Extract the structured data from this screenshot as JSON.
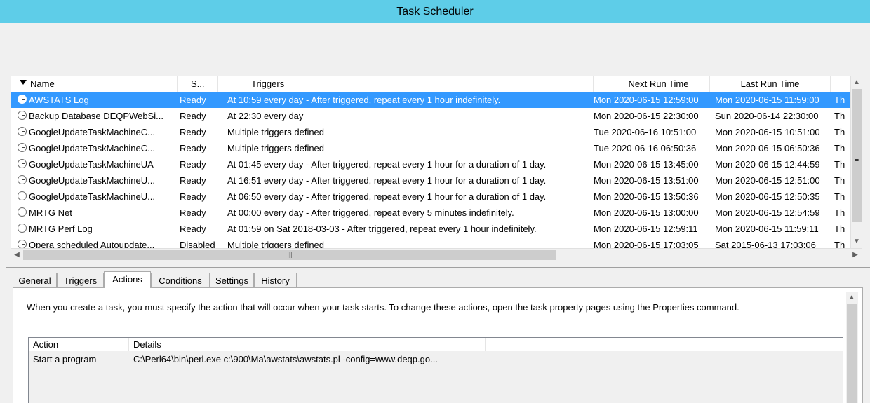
{
  "window": {
    "title": "Task Scheduler"
  },
  "task_list": {
    "columns": [
      "Name",
      "S...",
      "Triggers",
      "Next Run Time",
      "Last Run Time"
    ],
    "rows": [
      {
        "name": "AWSTATS Log",
        "status": "Ready",
        "triggers": "At 10:59 every day - After triggered, repeat every 1 hour indefinitely.",
        "next_run": "Mon 2020-06-15 12:59:00",
        "last_run": "Mon 2020-06-15 11:59:00",
        "extra": "Th",
        "selected": true
      },
      {
        "name": "Backup Database DEQPWebSi...",
        "status": "Ready",
        "triggers": "At 22:30 every day",
        "next_run": "Mon 2020-06-15 22:30:00",
        "last_run": "Sun 2020-06-14 22:30:00",
        "extra": "Th"
      },
      {
        "name": "GoogleUpdateTaskMachineC...",
        "status": "Ready",
        "triggers": "Multiple triggers defined",
        "next_run": "Tue 2020-06-16 10:51:00",
        "last_run": "Mon 2020-06-15 10:51:00",
        "extra": "Th"
      },
      {
        "name": "GoogleUpdateTaskMachineC...",
        "status": "Ready",
        "triggers": "Multiple triggers defined",
        "next_run": "Tue 2020-06-16 06:50:36",
        "last_run": "Mon 2020-06-15 06:50:36",
        "extra": "Th"
      },
      {
        "name": "GoogleUpdateTaskMachineUA",
        "status": "Ready",
        "triggers": "At 01:45 every day - After triggered, repeat every 1 hour for a duration of 1 day.",
        "next_run": "Mon 2020-06-15 13:45:00",
        "last_run": "Mon 2020-06-15 12:44:59",
        "extra": "Th"
      },
      {
        "name": "GoogleUpdateTaskMachineU...",
        "status": "Ready",
        "triggers": "At 16:51 every day - After triggered, repeat every 1 hour for a duration of 1 day.",
        "next_run": "Mon 2020-06-15 13:51:00",
        "last_run": "Mon 2020-06-15 12:51:00",
        "extra": "Th"
      },
      {
        "name": "GoogleUpdateTaskMachineU...",
        "status": "Ready",
        "triggers": "At 06:50 every day - After triggered, repeat every 1 hour for a duration of 1 day.",
        "next_run": "Mon 2020-06-15 13:50:36",
        "last_run": "Mon 2020-06-15 12:50:35",
        "extra": "Th"
      },
      {
        "name": "MRTG Net",
        "status": "Ready",
        "triggers": "At 00:00 every day - After triggered, repeat every 5 minutes indefinitely.",
        "next_run": "Mon 2020-06-15 13:00:00",
        "last_run": "Mon 2020-06-15 12:54:59",
        "extra": "Th"
      },
      {
        "name": "MRTG Perf Log",
        "status": "Ready",
        "triggers": "At 01:59 on Sat 2018-03-03 - After triggered, repeat every 1 hour indefinitely.",
        "next_run": "Mon 2020-06-15 12:59:11",
        "last_run": "Mon 2020-06-15 11:59:11",
        "extra": "Th"
      },
      {
        "name": "Opera scheduled Autoupdate...",
        "status": "Disabled",
        "triggers": "Multiple triggers defined",
        "next_run": "Mon 2020-06-15 17:03:05",
        "last_run": "Sat 2015-06-13 17:03:06",
        "extra": "Th"
      }
    ]
  },
  "tabs": [
    "General",
    "Triggers",
    "Actions",
    "Conditions",
    "Settings",
    "History"
  ],
  "active_tab": "Actions",
  "actions_panel": {
    "description": "When you create a task, you must specify the action that will occur when your task starts.  To change these actions, open the task property pages using the Properties command.",
    "columns": [
      "Action",
      "Details"
    ],
    "rows": [
      {
        "action": "Start a program",
        "details": "C:\\Perl64\\bin\\perl.exe c:\\900\\Ma\\awstats\\awstats.pl -config=www.deqp.go..."
      }
    ]
  }
}
